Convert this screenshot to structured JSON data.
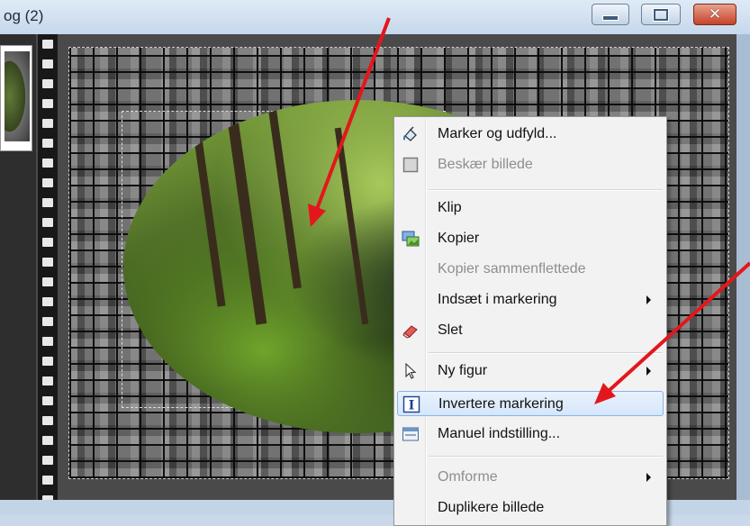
{
  "window": {
    "title": "og (2)",
    "min_icon": "minimize-icon",
    "max_icon": "maximize-icon",
    "close_icon": "close-icon",
    "close_glyph": "✕"
  },
  "context_menu": {
    "items": [
      {
        "label": "Marker og udfyld...",
        "icon": "paint-bucket-icon",
        "disabled": false
      },
      {
        "label": "Beskær billede",
        "icon": "crop-icon",
        "disabled": true
      },
      {
        "label": "Klip",
        "icon": "",
        "disabled": false
      },
      {
        "label": "Kopier",
        "icon": "copy-picture-icon",
        "disabled": false
      },
      {
        "label": "Kopier sammenflettede",
        "icon": "",
        "disabled": true
      },
      {
        "label": "Indsæt i markering",
        "icon": "",
        "disabled": false,
        "submenu": true
      },
      {
        "label": "Slet",
        "icon": "eraser-icon",
        "disabled": false
      },
      {
        "label": "Ny figur",
        "icon": "cursor-arrow-icon",
        "disabled": false,
        "submenu": true
      },
      {
        "label": "Invertere markering",
        "icon": "invert-selection-icon",
        "disabled": false,
        "highlighted": true
      },
      {
        "label": "Manuel indstilling...",
        "icon": "manual-settings-icon",
        "disabled": false
      },
      {
        "label": "Omforme",
        "icon": "",
        "disabled": true,
        "submenu": true
      },
      {
        "label": "Duplikere billede",
        "icon": "",
        "disabled": false
      }
    ]
  },
  "colors": {
    "annotation_arrow": "#e3171b",
    "highlight_border": "#89b3e5"
  }
}
